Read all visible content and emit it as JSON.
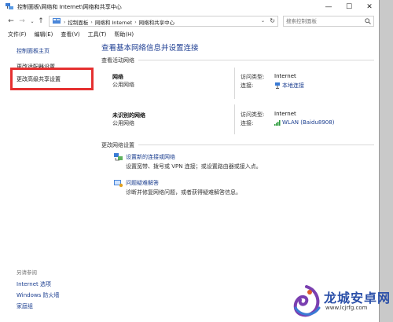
{
  "window": {
    "title": "控制面板\\网络和 Internet\\网络和共享中心",
    "minimize": "—",
    "maximize": "☐",
    "close": "✕"
  },
  "nav": {
    "back": "←",
    "forward": "→",
    "recent": "⌄",
    "up": "↑",
    "breadcrumbs": [
      "控制面板",
      "网络和 Internet",
      "网络和共享中心"
    ],
    "search_placeholder": "搜索控制面板"
  },
  "menu": [
    "文件(F)",
    "编辑(E)",
    "查看(V)",
    "工具(T)",
    "帮助(H)"
  ],
  "sidebar": {
    "home": "控制面板主页",
    "change_adapter": "更改适配器设置",
    "advanced_sharing": "更改高级共享设置",
    "see_also": "另请参阅",
    "internet_options": "Internet 选项",
    "firewall": "Windows 防火墙",
    "homegroup": "家庭组"
  },
  "main": {
    "title": "查看基本网络信息并设置连接",
    "active_networks_label": "查看活动网络",
    "networks": [
      {
        "name": "网络",
        "category": "公用网络",
        "access_label": "访问类型:",
        "access_value": "Internet",
        "conn_label": "连接:",
        "conn_value": "本地连接"
      },
      {
        "name": "未识别的网络",
        "category": "公用网络",
        "access_label": "访问类型:",
        "access_value": "Internet",
        "conn_label": "连接:",
        "conn_value": "WLAN (Baidu8908)"
      }
    ],
    "change_settings_label": "更改网络设置",
    "tasks": [
      {
        "link": "设置新的连接或网络",
        "desc": "设置宽带、拨号或 VPN 连接；或设置路由器或接入点。"
      },
      {
        "link": "问题疑难解答",
        "desc": "诊断并修复网络问题，或者获得疑难解答信息。"
      }
    ]
  },
  "watermark": {
    "brand": "龙城安卓网",
    "url": "www.lcjrfg.com"
  },
  "colors": {
    "link": "#1a3d8f",
    "title": "#1f3f93",
    "highlight": "#e53030"
  }
}
